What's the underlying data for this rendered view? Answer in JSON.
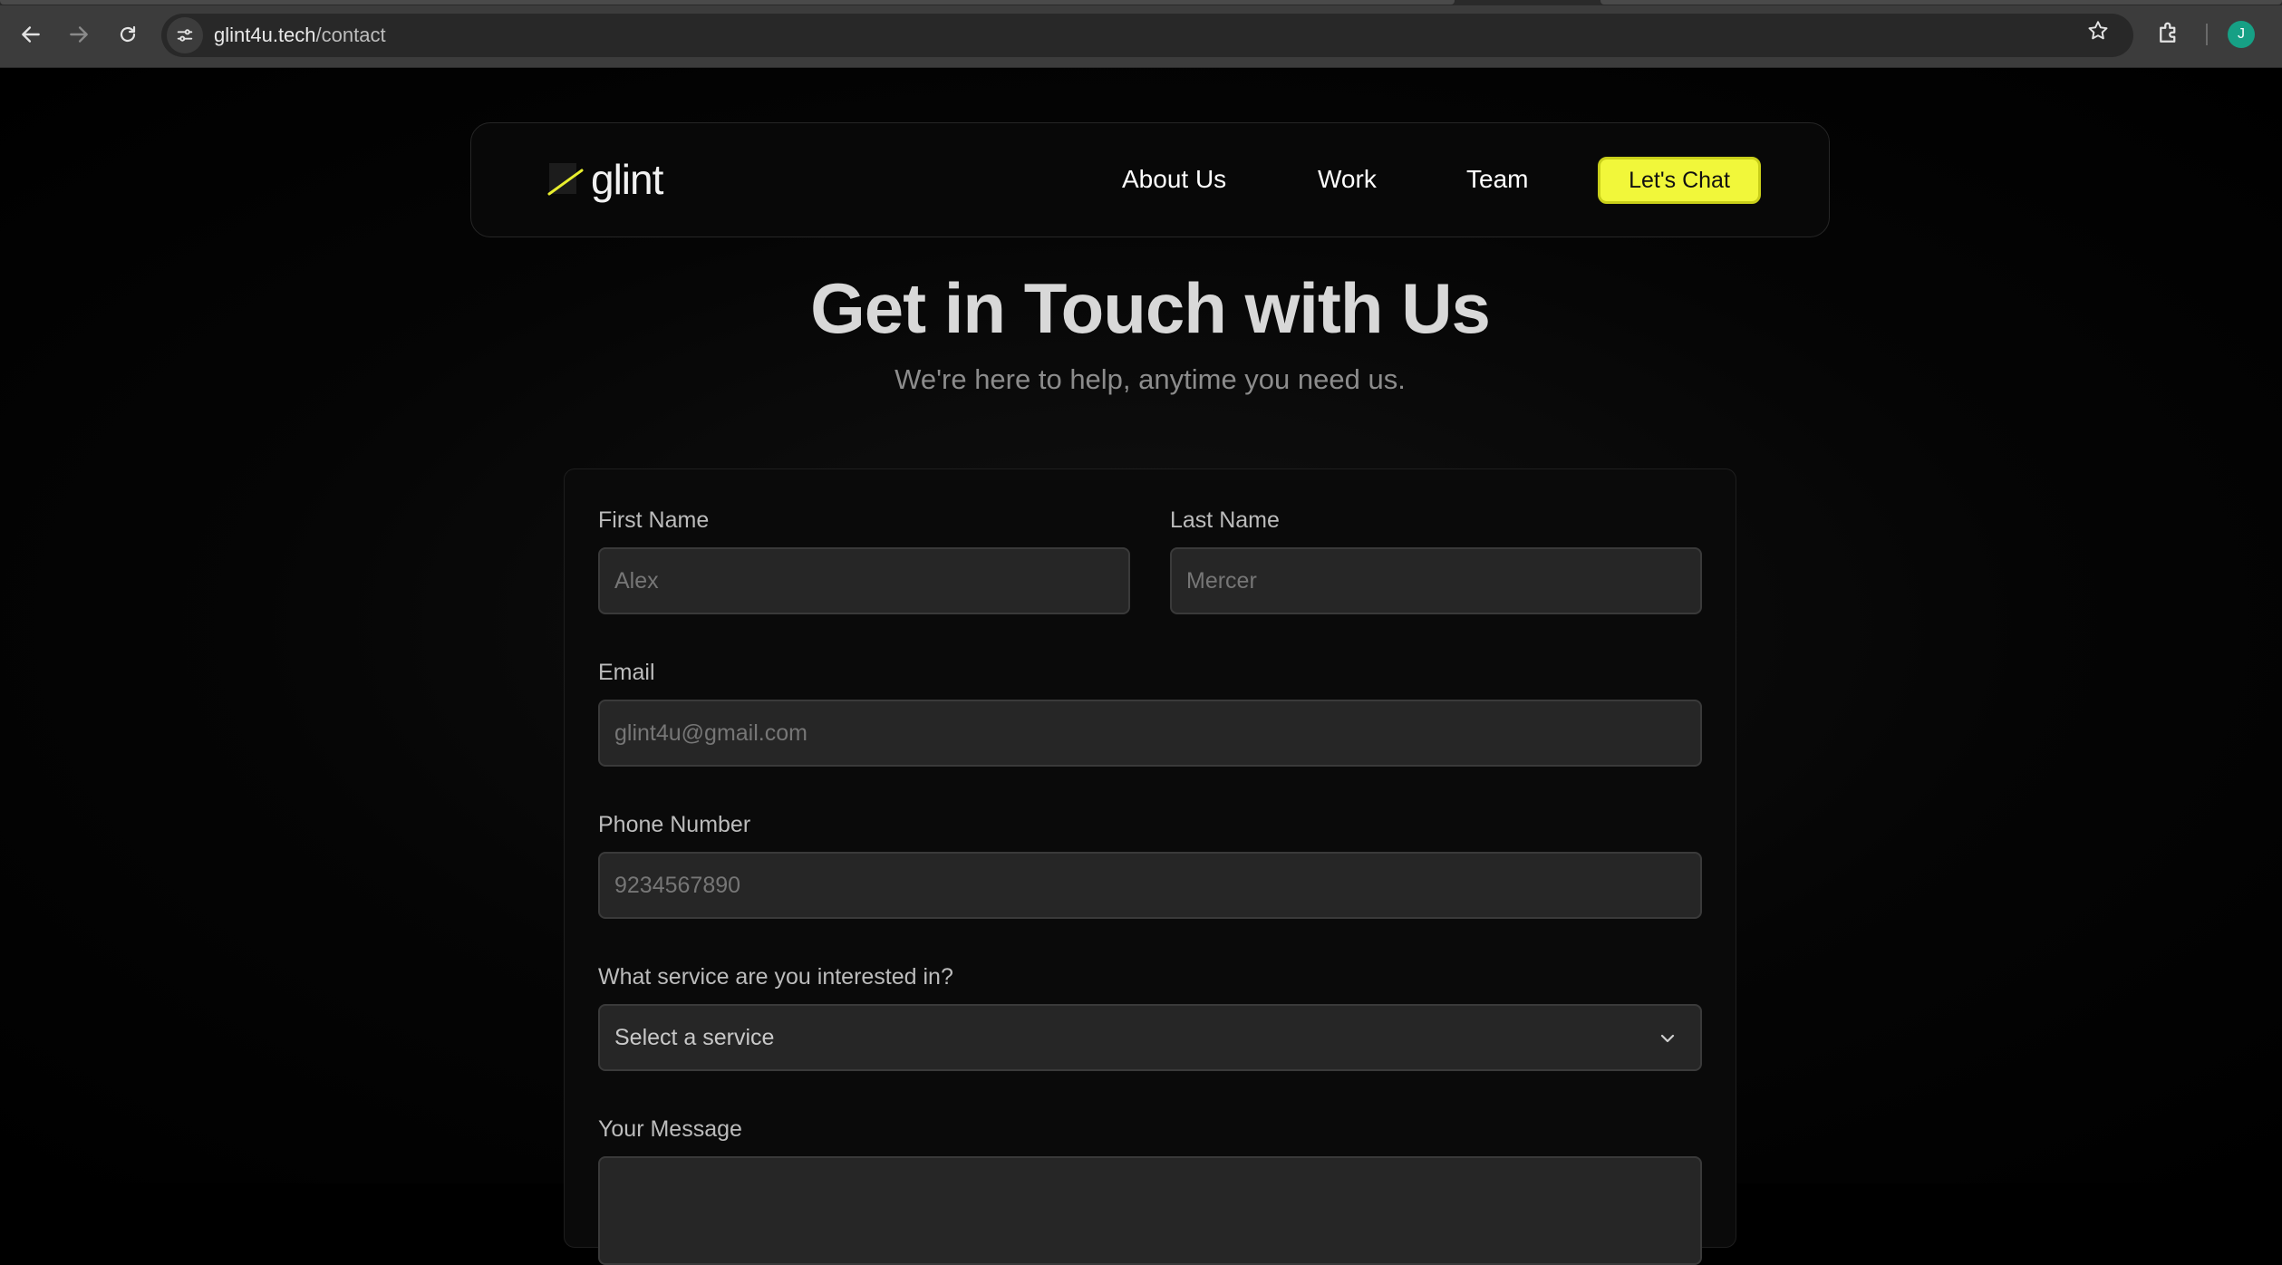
{
  "browser": {
    "url_host": "glint4u.tech",
    "url_path": "/contact",
    "avatar_initial": "J"
  },
  "nav": {
    "logo_text": "glint",
    "links": [
      "About Us",
      "Work",
      "Team"
    ],
    "cta_label": "Let's Chat",
    "accent_color": "#f1f73a"
  },
  "hero": {
    "title": "Get in Touch with Us",
    "subtitle": "We're here to help, anytime you need us."
  },
  "form": {
    "first_name": {
      "label": "First Name",
      "placeholder": "Alex"
    },
    "last_name": {
      "label": "Last Name",
      "placeholder": "Mercer"
    },
    "email": {
      "label": "Email",
      "placeholder": "glint4u@gmail.com"
    },
    "phone": {
      "label": "Phone Number",
      "placeholder": "9234567890"
    },
    "service": {
      "label": "What service are you interested in?",
      "selected": "Select a service"
    },
    "message": {
      "label": "Your Message"
    }
  }
}
